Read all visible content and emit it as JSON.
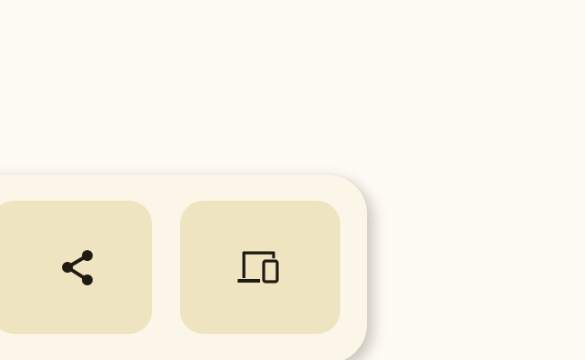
{
  "actions": [
    {
      "id": "share",
      "icon": "share-icon"
    },
    {
      "id": "devices",
      "icon": "devices-icon"
    }
  ],
  "colors": {
    "page_background": "#fefbf5",
    "panel_background": "#fbf6e8",
    "button_background": "#efe4c0",
    "icon_color": "#1f1b12"
  }
}
